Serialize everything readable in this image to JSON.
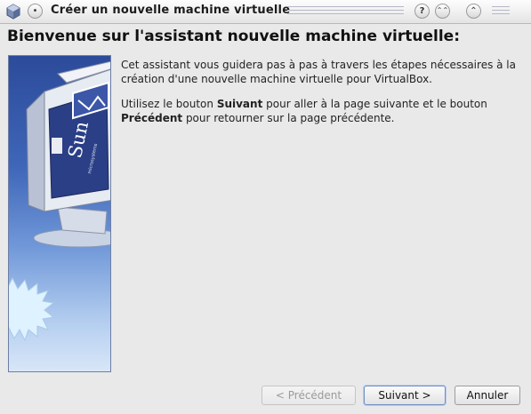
{
  "window": {
    "title": "Créer un nouvelle machine virtuelle",
    "system_menu_icon": "virtualbox-cube-icon",
    "controls": {
      "menu": "•",
      "help": "?",
      "shade": "⌃⌃",
      "maximize": "⌃"
    }
  },
  "wizard": {
    "heading": "Bienvenue sur l'assistant nouvelle machine virtuelle:",
    "paragraph1": "Cet assistant vous guidera pas à pas à travers les étapes nécessaires à la création d'une nouvelle machine virtuelle pour VirtualBox.",
    "paragraph2": {
      "part1": "Utilisez le bouton ",
      "bold1": "Suivant",
      "part2": " pour aller à la page suivante et le bouton ",
      "bold2": "Précédent",
      "part3": " pour retourner sur la page précédente."
    },
    "watermark_logo_text": "Sun",
    "watermark_logo_subtext": "microsystems"
  },
  "buttons": {
    "back": "< Précédent",
    "next": "Suivant >",
    "cancel": "Annuler"
  },
  "colors": {
    "watermark_top": "#2c4b9a",
    "watermark_bottom": "#d8e6f8",
    "default_button_border": "#6f8fc8"
  }
}
